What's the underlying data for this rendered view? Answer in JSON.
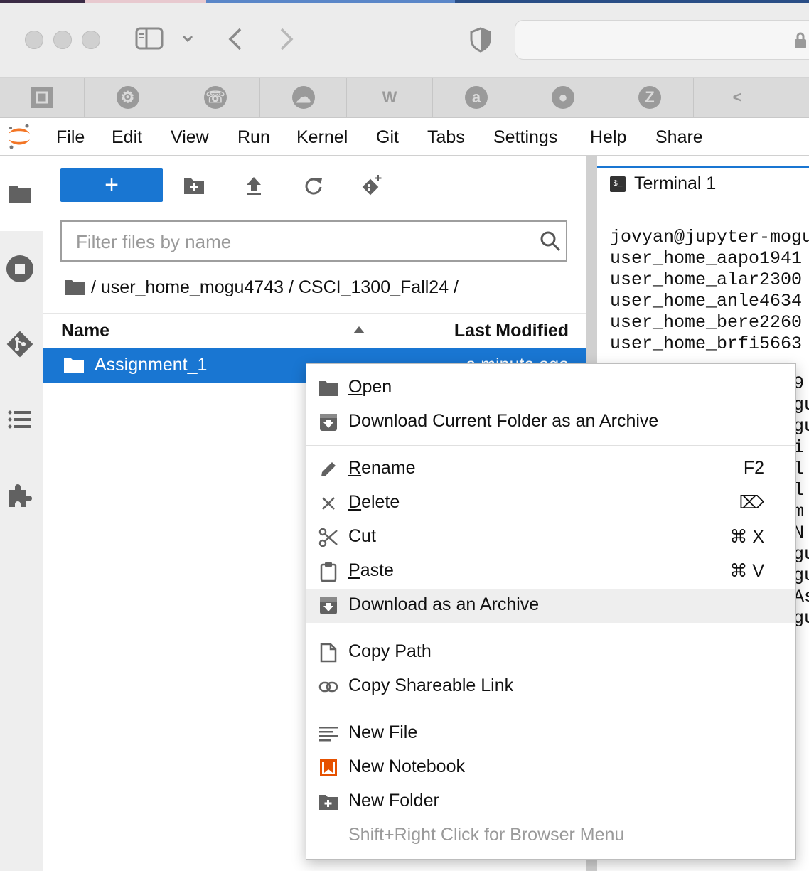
{
  "menubar": {
    "items": [
      "File",
      "Edit",
      "View",
      "Run",
      "Kernel",
      "Git",
      "Tabs",
      "Settings",
      "Help",
      "Share"
    ]
  },
  "toolbar": {
    "new_label": "+"
  },
  "filter": {
    "placeholder": "Filter files by name"
  },
  "breadcrumb": {
    "text": "/ user_home_mogu4743 / CSCI_1300_Fall24 /"
  },
  "filelist": {
    "col_name": "Name",
    "col_modified": "Last Modified",
    "rows": [
      {
        "name": "Assignment_1",
        "modified": "a minute ago"
      }
    ]
  },
  "terminal": {
    "tab_label": "Terminal 1",
    "prompt_icon": "$_",
    "lines": [
      "jovyan@jupyter-mogu",
      "user_home_aapo1941",
      "user_home_alar2300",
      "user_home_anle4634",
      "user_home_bere2260",
      "user_home_brfi5663"
    ],
    "overflow_chars": [
      "9",
      "gu",
      "gu",
      "i",
      "l",
      "l",
      "m",
      "N",
      "gu",
      "gu",
      "As",
      "gu"
    ]
  },
  "context_menu": {
    "groups": [
      [
        {
          "pre": "",
          "ul": "O",
          "post": "pen",
          "shortcut": "",
          "icon": "folder-icon"
        },
        {
          "pre": "Download Current Folder as an Archive",
          "ul": "",
          "post": "",
          "shortcut": "",
          "icon": "download-icon"
        }
      ],
      [
        {
          "pre": "",
          "ul": "R",
          "post": "ename",
          "shortcut": "F2",
          "icon": "pencil-icon"
        },
        {
          "pre": "",
          "ul": "D",
          "post": "elete",
          "shortcut": "⌦",
          "icon": "close-icon"
        },
        {
          "pre": "Cut",
          "ul": "",
          "post": "",
          "shortcut": "⌘ X",
          "icon": "scissors-icon"
        },
        {
          "pre": "",
          "ul": "P",
          "post": "aste",
          "shortcut": "⌘ V",
          "icon": "clipboard-icon"
        },
        {
          "pre": "Download as an Archive",
          "ul": "",
          "post": "",
          "shortcut": "",
          "icon": "download-icon"
        }
      ],
      [
        {
          "pre": "Copy Path",
          "ul": "",
          "post": "",
          "shortcut": "",
          "icon": "file-icon"
        },
        {
          "pre": "Copy Shareable Link",
          "ul": "",
          "post": "",
          "shortcut": "",
          "icon": "link-icon"
        }
      ],
      [
        {
          "pre": "New File",
          "ul": "",
          "post": "",
          "shortcut": "",
          "icon": "text-file-icon"
        },
        {
          "pre": "New Notebook",
          "ul": "",
          "post": "",
          "shortcut": "",
          "icon": "notebook-icon"
        },
        {
          "pre": "New Folder",
          "ul": "",
          "post": "",
          "shortcut": "",
          "icon": "new-folder-icon"
        }
      ]
    ],
    "footer": "Shift+Right Click for Browser Menu",
    "highlighted": "Download as an Archive"
  },
  "colors": {
    "accent": "#1976d2",
    "notebook_orange": "#e65100",
    "icon_gray": "#616161"
  }
}
